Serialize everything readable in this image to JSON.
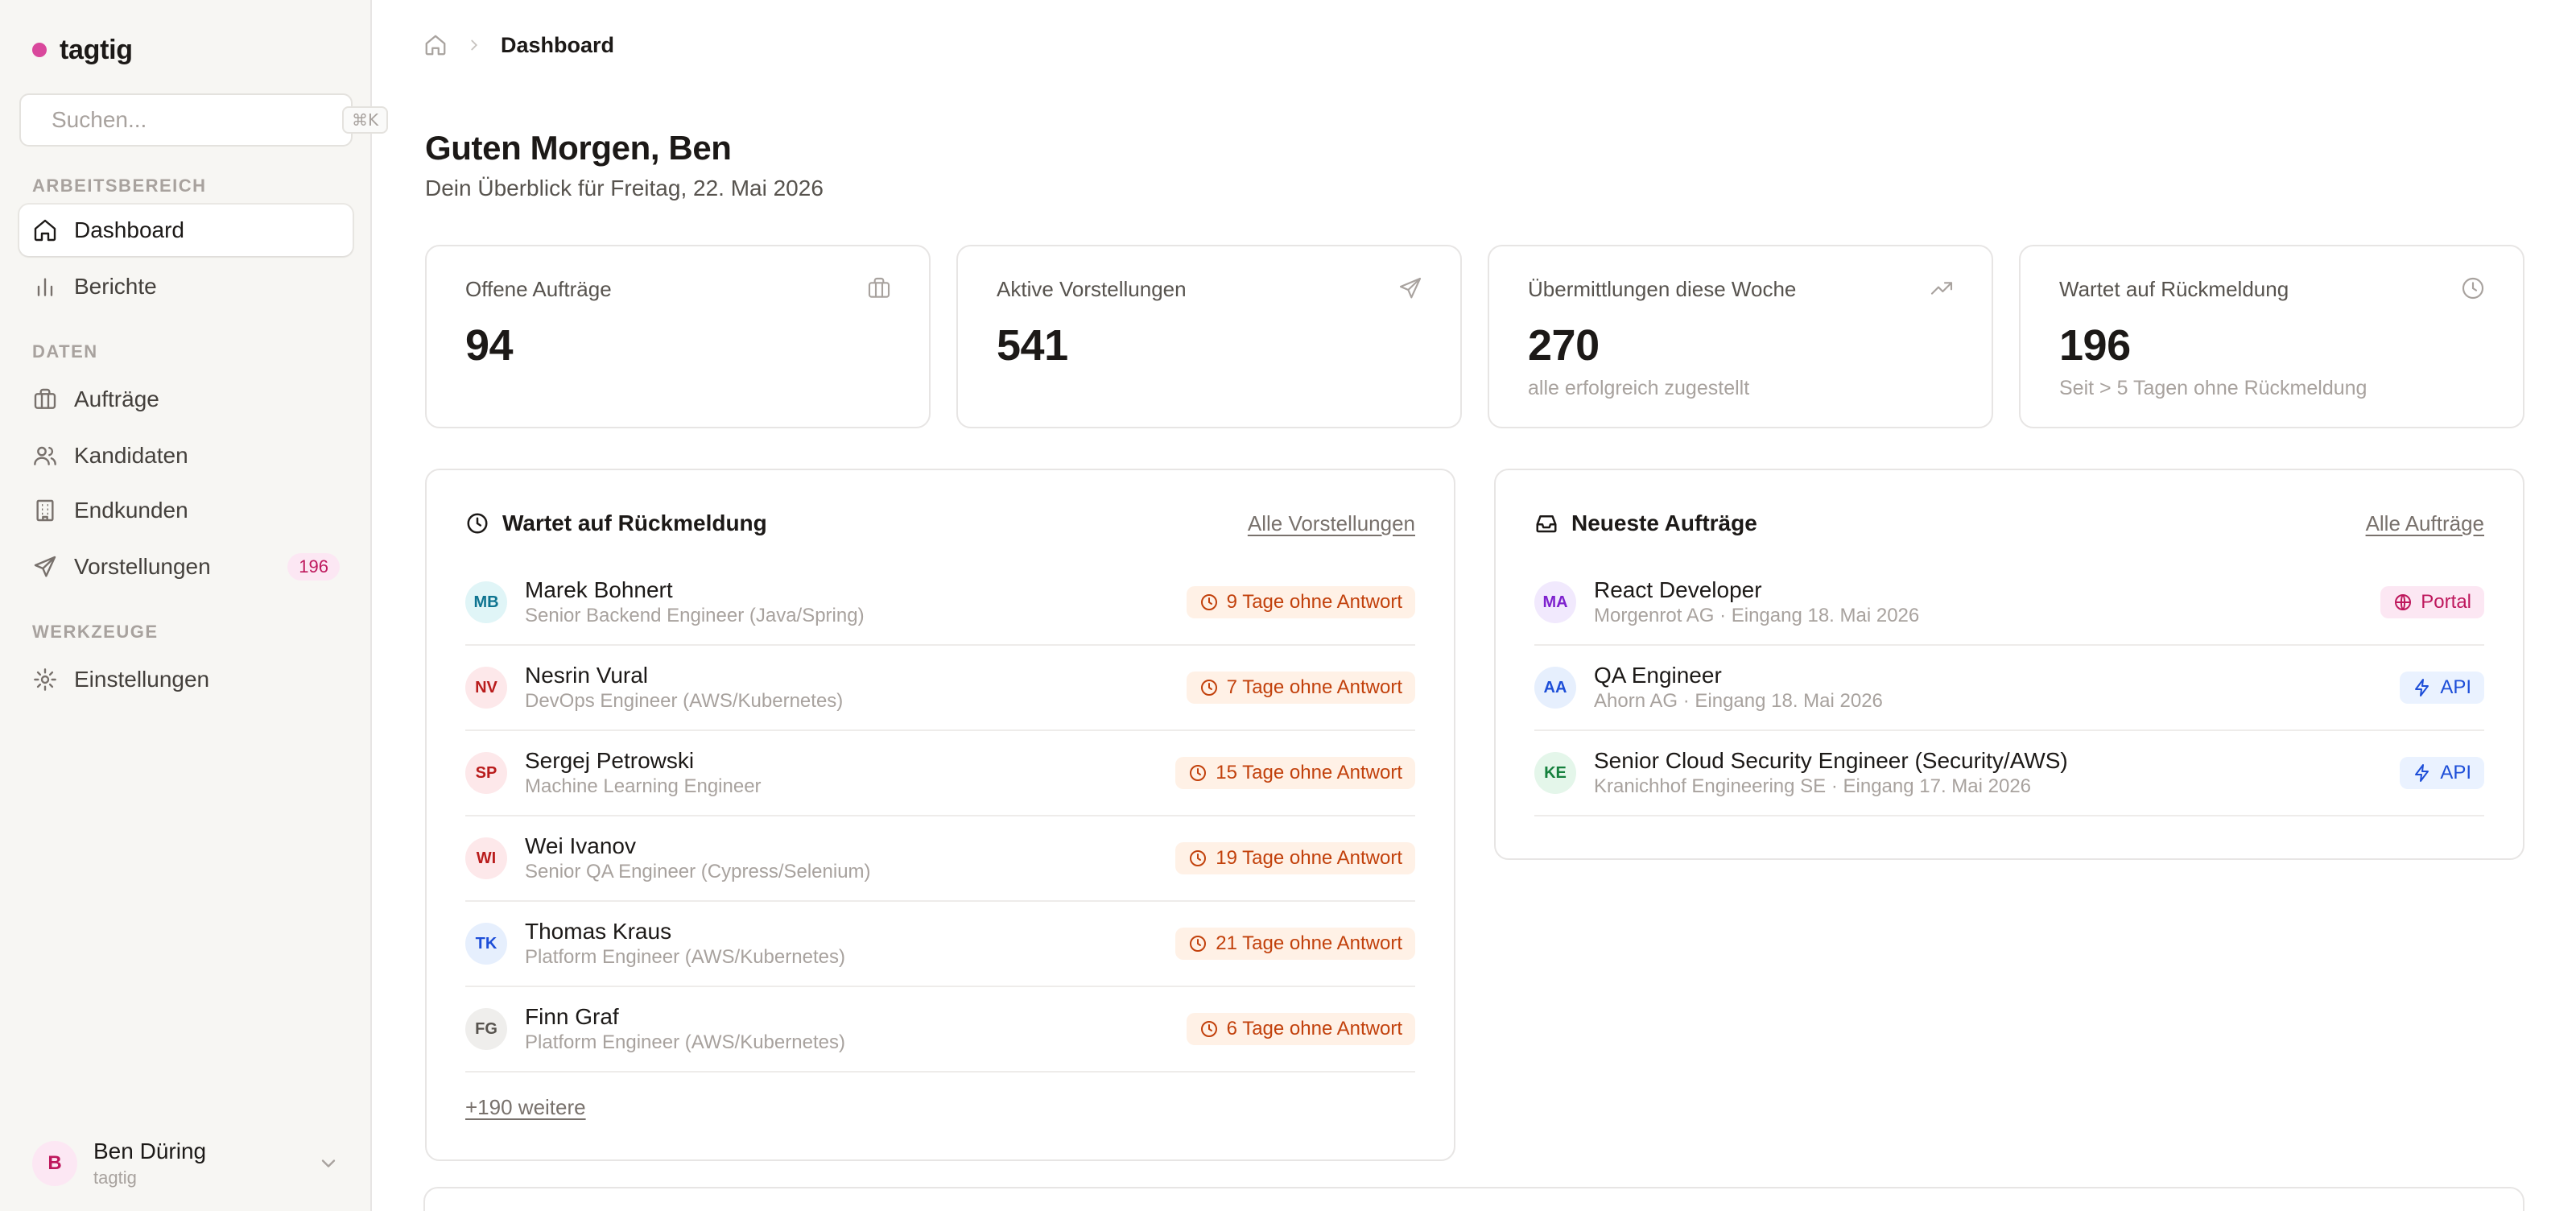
{
  "app": {
    "name": "tagtig",
    "brand_color": "#d9489c"
  },
  "search": {
    "placeholder": "Suchen...",
    "shortcut": "⌘K"
  },
  "sidebar": {
    "sections": [
      {
        "label": "ARBEITSBEREICH"
      },
      {
        "label": "DATEN"
      },
      {
        "label": "WERKZEUGE"
      }
    ],
    "items": [
      {
        "label": "Dashboard",
        "icon": "home-icon",
        "active": true
      },
      {
        "label": "Berichte",
        "icon": "bar-chart-icon"
      },
      {
        "label": "Aufträge",
        "icon": "briefcase-icon"
      },
      {
        "label": "Kandidaten",
        "icon": "users-icon"
      },
      {
        "label": "Endkunden",
        "icon": "building-icon"
      },
      {
        "label": "Vorstellungen",
        "icon": "send-icon",
        "badge": "196"
      },
      {
        "label": "Einstellungen",
        "icon": "gear-icon"
      }
    ]
  },
  "user": {
    "initial": "B",
    "name": "Ben Düring",
    "org": "tagtig"
  },
  "breadcrumb": {
    "current": "Dashboard"
  },
  "header": {
    "greeting": "Guten Morgen, Ben",
    "subtitle": "Dein Überblick für Freitag, 22. Mai 2026"
  },
  "stats": [
    {
      "label": "Offene Aufträge",
      "value": "94",
      "note": "",
      "icon": "briefcase-icon"
    },
    {
      "label": "Aktive Vorstellungen",
      "value": "541",
      "note": "",
      "icon": "send-icon"
    },
    {
      "label": "Übermittlungen diese Woche",
      "value": "270",
      "note": "alle erfolgreich zugestellt",
      "icon": "trending-up-icon"
    },
    {
      "label": "Wartet auf Rückmeldung",
      "value": "196",
      "note": "Seit > 5 Tagen ohne Rückmeldung",
      "icon": "clock-icon"
    }
  ],
  "waiting": {
    "title": "Wartet auf Rückmeldung",
    "link": "Alle Vorstellungen",
    "more": "+190 weitere",
    "rows": [
      {
        "initials": "MB",
        "name": "Marek Bohnert",
        "role": "Senior Backend Engineer (Java/Spring)",
        "status": "9 Tage ohne Antwort",
        "avatar_bg": "#e0f5f7",
        "avatar_fg": "#0e7490"
      },
      {
        "initials": "NV",
        "name": "Nesrin Vural",
        "role": "DevOps Engineer (AWS/Kubernetes)",
        "status": "7 Tage ohne Antwort",
        "avatar_bg": "#fde8ea",
        "avatar_fg": "#b91c1c"
      },
      {
        "initials": "SP",
        "name": "Sergej Petrowski",
        "role": "Machine Learning Engineer",
        "status": "15 Tage ohne Antwort",
        "avatar_bg": "#fde8ea",
        "avatar_fg": "#b91c1c"
      },
      {
        "initials": "WI",
        "name": "Wei Ivanov",
        "role": "Senior QA Engineer (Cypress/Selenium)",
        "status": "19 Tage ohne Antwort",
        "avatar_bg": "#fde8ea",
        "avatar_fg": "#b91c1c"
      },
      {
        "initials": "TK",
        "name": "Thomas Kraus",
        "role": "Platform Engineer (AWS/Kubernetes)",
        "status": "21 Tage ohne Antwort",
        "avatar_bg": "#e6effd",
        "avatar_fg": "#1d4ed8"
      },
      {
        "initials": "FG",
        "name": "Finn Graf",
        "role": "Platform Engineer (AWS/Kubernetes)",
        "status": "6 Tage ohne Antwort",
        "avatar_bg": "#efeeec",
        "avatar_fg": "#57534e"
      }
    ]
  },
  "orders": {
    "title": "Neueste Aufträge",
    "link": "Alle Aufträge",
    "rows": [
      {
        "initials": "MA",
        "title": "React Developer",
        "meta": "Morgenrot AG · Eingang 18. Mai 2026",
        "source": "Portal",
        "source_icon": "globe-icon",
        "avatar_bg": "#f1e9fd",
        "avatar_fg": "#7e22ce"
      },
      {
        "initials": "AA",
        "title": "QA Engineer",
        "meta": "Ahorn AG · Eingang 18. Mai 2026",
        "source": "API",
        "source_icon": "bolt-icon",
        "avatar_bg": "#e6effd",
        "avatar_fg": "#1d4ed8"
      },
      {
        "initials": "KE",
        "title": "Senior Cloud Security Engineer (Security/AWS)",
        "meta": "Kranichhof Engineering SE · Eingang 17. Mai 2026",
        "source": "API",
        "source_icon": "bolt-icon",
        "avatar_bg": "#e4f6ea",
        "avatar_fg": "#15803d"
      }
    ]
  }
}
